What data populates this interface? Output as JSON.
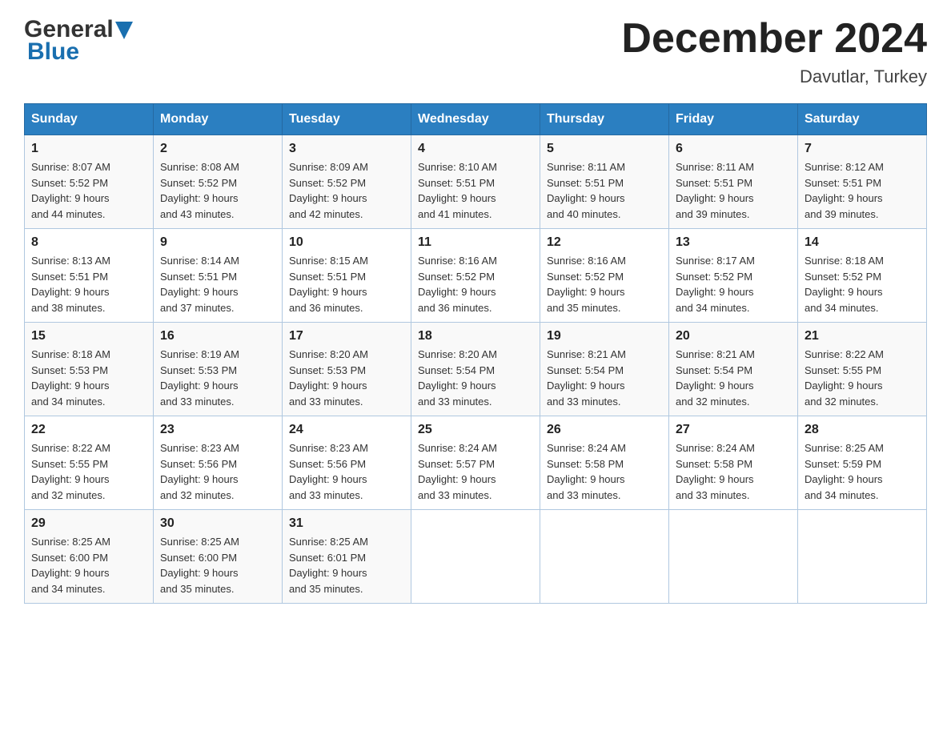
{
  "logo": {
    "general": "General",
    "blue": "Blue"
  },
  "title": {
    "month": "December 2024",
    "location": "Davutlar, Turkey"
  },
  "headers": [
    "Sunday",
    "Monday",
    "Tuesday",
    "Wednesday",
    "Thursday",
    "Friday",
    "Saturday"
  ],
  "weeks": [
    [
      {
        "day": "1",
        "sunrise": "8:07 AM",
        "sunset": "5:52 PM",
        "daylight": "9 hours and 44 minutes."
      },
      {
        "day": "2",
        "sunrise": "8:08 AM",
        "sunset": "5:52 PM",
        "daylight": "9 hours and 43 minutes."
      },
      {
        "day": "3",
        "sunrise": "8:09 AM",
        "sunset": "5:52 PM",
        "daylight": "9 hours and 42 minutes."
      },
      {
        "day": "4",
        "sunrise": "8:10 AM",
        "sunset": "5:51 PM",
        "daylight": "9 hours and 41 minutes."
      },
      {
        "day": "5",
        "sunrise": "8:11 AM",
        "sunset": "5:51 PM",
        "daylight": "9 hours and 40 minutes."
      },
      {
        "day": "6",
        "sunrise": "8:11 AM",
        "sunset": "5:51 PM",
        "daylight": "9 hours and 39 minutes."
      },
      {
        "day": "7",
        "sunrise": "8:12 AM",
        "sunset": "5:51 PM",
        "daylight": "9 hours and 39 minutes."
      }
    ],
    [
      {
        "day": "8",
        "sunrise": "8:13 AM",
        "sunset": "5:51 PM",
        "daylight": "9 hours and 38 minutes."
      },
      {
        "day": "9",
        "sunrise": "8:14 AM",
        "sunset": "5:51 PM",
        "daylight": "9 hours and 37 minutes."
      },
      {
        "day": "10",
        "sunrise": "8:15 AM",
        "sunset": "5:51 PM",
        "daylight": "9 hours and 36 minutes."
      },
      {
        "day": "11",
        "sunrise": "8:16 AM",
        "sunset": "5:52 PM",
        "daylight": "9 hours and 36 minutes."
      },
      {
        "day": "12",
        "sunrise": "8:16 AM",
        "sunset": "5:52 PM",
        "daylight": "9 hours and 35 minutes."
      },
      {
        "day": "13",
        "sunrise": "8:17 AM",
        "sunset": "5:52 PM",
        "daylight": "9 hours and 34 minutes."
      },
      {
        "day": "14",
        "sunrise": "8:18 AM",
        "sunset": "5:52 PM",
        "daylight": "9 hours and 34 minutes."
      }
    ],
    [
      {
        "day": "15",
        "sunrise": "8:18 AM",
        "sunset": "5:53 PM",
        "daylight": "9 hours and 34 minutes."
      },
      {
        "day": "16",
        "sunrise": "8:19 AM",
        "sunset": "5:53 PM",
        "daylight": "9 hours and 33 minutes."
      },
      {
        "day": "17",
        "sunrise": "8:20 AM",
        "sunset": "5:53 PM",
        "daylight": "9 hours and 33 minutes."
      },
      {
        "day": "18",
        "sunrise": "8:20 AM",
        "sunset": "5:54 PM",
        "daylight": "9 hours and 33 minutes."
      },
      {
        "day": "19",
        "sunrise": "8:21 AM",
        "sunset": "5:54 PM",
        "daylight": "9 hours and 33 minutes."
      },
      {
        "day": "20",
        "sunrise": "8:21 AM",
        "sunset": "5:54 PM",
        "daylight": "9 hours and 32 minutes."
      },
      {
        "day": "21",
        "sunrise": "8:22 AM",
        "sunset": "5:55 PM",
        "daylight": "9 hours and 32 minutes."
      }
    ],
    [
      {
        "day": "22",
        "sunrise": "8:22 AM",
        "sunset": "5:55 PM",
        "daylight": "9 hours and 32 minutes."
      },
      {
        "day": "23",
        "sunrise": "8:23 AM",
        "sunset": "5:56 PM",
        "daylight": "9 hours and 32 minutes."
      },
      {
        "day": "24",
        "sunrise": "8:23 AM",
        "sunset": "5:56 PM",
        "daylight": "9 hours and 33 minutes."
      },
      {
        "day": "25",
        "sunrise": "8:24 AM",
        "sunset": "5:57 PM",
        "daylight": "9 hours and 33 minutes."
      },
      {
        "day": "26",
        "sunrise": "8:24 AM",
        "sunset": "5:58 PM",
        "daylight": "9 hours and 33 minutes."
      },
      {
        "day": "27",
        "sunrise": "8:24 AM",
        "sunset": "5:58 PM",
        "daylight": "9 hours and 33 minutes."
      },
      {
        "day": "28",
        "sunrise": "8:25 AM",
        "sunset": "5:59 PM",
        "daylight": "9 hours and 34 minutes."
      }
    ],
    [
      {
        "day": "29",
        "sunrise": "8:25 AM",
        "sunset": "6:00 PM",
        "daylight": "9 hours and 34 minutes."
      },
      {
        "day": "30",
        "sunrise": "8:25 AM",
        "sunset": "6:00 PM",
        "daylight": "9 hours and 35 minutes."
      },
      {
        "day": "31",
        "sunrise": "8:25 AM",
        "sunset": "6:01 PM",
        "daylight": "9 hours and 35 minutes."
      },
      null,
      null,
      null,
      null
    ]
  ],
  "labels": {
    "sunrise": "Sunrise:",
    "sunset": "Sunset:",
    "daylight": "Daylight:"
  }
}
